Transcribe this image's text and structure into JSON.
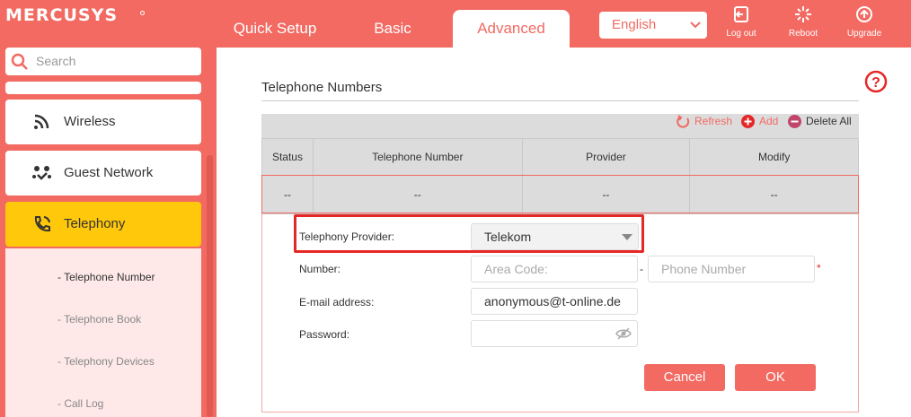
{
  "header": {
    "logo": "MERCUSYS",
    "tabs": [
      "Quick Setup",
      "Basic",
      "Advanced"
    ],
    "language": "English",
    "buttons": {
      "logout": "Log out",
      "reboot": "Reboot",
      "upgrade": "Upgrade"
    }
  },
  "sidebar": {
    "search_placeholder": "Search",
    "items": [
      "Wireless",
      "Guest Network",
      "Telephony"
    ],
    "sub_items": [
      "- Telephone Number",
      "- Telephone Book",
      "- Telephony Devices",
      "- Call Log"
    ]
  },
  "main": {
    "section_title": "Telephone Numbers",
    "toolbar": {
      "refresh": "Refresh",
      "add": "Add",
      "delete_all": "Delete All"
    },
    "table": {
      "headers": [
        "Status",
        "Telephone Number",
        "Provider",
        "Modify"
      ],
      "row": [
        "--",
        "--",
        "--",
        "--"
      ]
    },
    "form": {
      "provider_label": "Telephony Provider:",
      "provider_value": "Telekom",
      "number_label": "Number:",
      "area_code_placeholder": "Area Code:",
      "dash": "-",
      "phone_placeholder": "Phone Number",
      "required_mark": "*",
      "email_label": "E-mail address:",
      "email_value": "anonymous@t-online.de",
      "password_label": "Password:",
      "cancel": "Cancel",
      "ok": "OK"
    }
  },
  "colors": {
    "brand": "#f26a62",
    "active_item": "#ffc80a",
    "highlight": "#e52727"
  }
}
